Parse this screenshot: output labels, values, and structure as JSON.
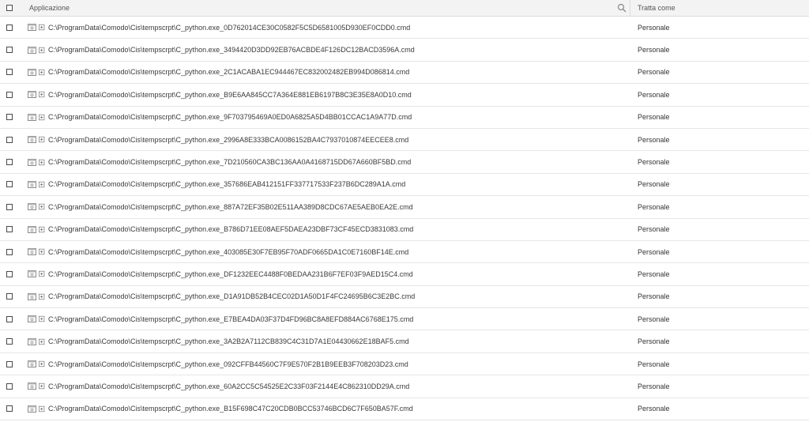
{
  "header": {
    "app_col": "Applicazione",
    "treat_col": "Tratta come"
  },
  "rows": [
    {
      "path": "C:\\ProgramData\\Comodo\\Cis\\tempscrpt\\C_python.exe_0D762014CE30C0582F5C5D6581005D930EF0CDD0.cmd",
      "treat": "Personale"
    },
    {
      "path": "C:\\ProgramData\\Comodo\\Cis\\tempscrpt\\C_python.exe_3494420D3DD92EB76ACBDE4F126DC12BACD3596A.cmd",
      "treat": "Personale"
    },
    {
      "path": "C:\\ProgramData\\Comodo\\Cis\\tempscrpt\\C_python.exe_2C1ACABA1EC944467EC832002482EB994D086814.cmd",
      "treat": "Personale"
    },
    {
      "path": "C:\\ProgramData\\Comodo\\Cis\\tempscrpt\\C_python.exe_B9E6AA845CC7A364E881EB6197B8C3E35E8A0D10.cmd",
      "treat": "Personale"
    },
    {
      "path": "C:\\ProgramData\\Comodo\\Cis\\tempscrpt\\C_python.exe_9F703795469A0ED0A6825A5D4BB01CCAC1A9A77D.cmd",
      "treat": "Personale"
    },
    {
      "path": "C:\\ProgramData\\Comodo\\Cis\\tempscrpt\\C_python.exe_2996A8E333BCA0086152BA4C7937010874EECEE8.cmd",
      "treat": "Personale"
    },
    {
      "path": "C:\\ProgramData\\Comodo\\Cis\\tempscrpt\\C_python.exe_7D210560CA3BC136AA0A4168715DD67A660BF5BD.cmd",
      "treat": "Personale"
    },
    {
      "path": "C:\\ProgramData\\Comodo\\Cis\\tempscrpt\\C_python.exe_357686EAB412151FF337717533F237B6DC289A1A.cmd",
      "treat": "Personale"
    },
    {
      "path": "C:\\ProgramData\\Comodo\\Cis\\tempscrpt\\C_python.exe_887A72EF35B02E511AA389D8CDC67AE5AEB0EA2E.cmd",
      "treat": "Personale"
    },
    {
      "path": "C:\\ProgramData\\Comodo\\Cis\\tempscrpt\\C_python.exe_B786D71EE08AEF5DAEA23DBF73CF45ECD3831083.cmd",
      "treat": "Personale"
    },
    {
      "path": "C:\\ProgramData\\Comodo\\Cis\\tempscrpt\\C_python.exe_403085E30F7EB95F70ADF0665DA1C0E7160BF14E.cmd",
      "treat": "Personale"
    },
    {
      "path": "C:\\ProgramData\\Comodo\\Cis\\tempscrpt\\C_python.exe_DF1232EEC4488F0BEDAA231B6F7EF03F9AED15C4.cmd",
      "treat": "Personale"
    },
    {
      "path": "C:\\ProgramData\\Comodo\\Cis\\tempscrpt\\C_python.exe_D1A91DB52B4CEC02D1A50D1F4FC24695B6C3E2BC.cmd",
      "treat": "Personale"
    },
    {
      "path": "C:\\ProgramData\\Comodo\\Cis\\tempscrpt\\C_python.exe_E7BEA4DA03F37D4FD96BC8A8EFD884AC6768E175.cmd",
      "treat": "Personale"
    },
    {
      "path": "C:\\ProgramData\\Comodo\\Cis\\tempscrpt\\C_python.exe_3A2B2A7112CB839C4C31D7A1E04430662E18BAF5.cmd",
      "treat": "Personale"
    },
    {
      "path": "C:\\ProgramData\\Comodo\\Cis\\tempscrpt\\C_python.exe_092CFFB44560C7F9E570F2B1B9EEB3F708203D23.cmd",
      "treat": "Personale"
    },
    {
      "path": "C:\\ProgramData\\Comodo\\Cis\\tempscrpt\\C_python.exe_60A2CC5C54525E2C33F03F2144E4C862310DD29A.cmd",
      "treat": "Personale"
    },
    {
      "path": "C:\\ProgramData\\Comodo\\Cis\\tempscrpt\\C_python.exe_B15F698C47C20CDB0BCC53746BCD6C7F650BA57F.cmd",
      "treat": "Personale"
    }
  ],
  "icons": {
    "search": "search-icon",
    "row_app": "application-icon",
    "row_expand": "expand-icon"
  }
}
